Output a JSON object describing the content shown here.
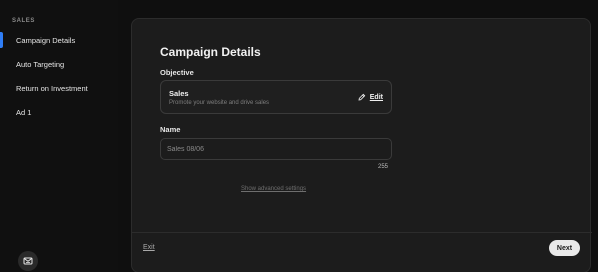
{
  "sidebar": {
    "section": "SALES",
    "items": [
      {
        "label": "Campaign Details",
        "active": true
      },
      {
        "label": "Auto Targeting",
        "active": false
      },
      {
        "label": "Return on Investment",
        "active": false
      },
      {
        "label": "Ad 1",
        "active": false
      }
    ],
    "support_icon": "message-envelope-icon"
  },
  "main": {
    "title": "Campaign Details",
    "objective": {
      "label": "Objective",
      "name": "Sales",
      "description": "Promote your website and drive sales",
      "edit_label": "Edit",
      "edit_icon": "pencil-icon"
    },
    "name_field": {
      "label": "Name",
      "placeholder": "Sales 08/06",
      "value": "",
      "char_count": "255"
    },
    "advanced_link": "Show advanced settings"
  },
  "footer": {
    "exit_label": "Exit",
    "next_label": "Next"
  },
  "colors": {
    "accent": "#2f7df6",
    "background": "#0f0f0f",
    "panel": "#1c1c1c"
  }
}
